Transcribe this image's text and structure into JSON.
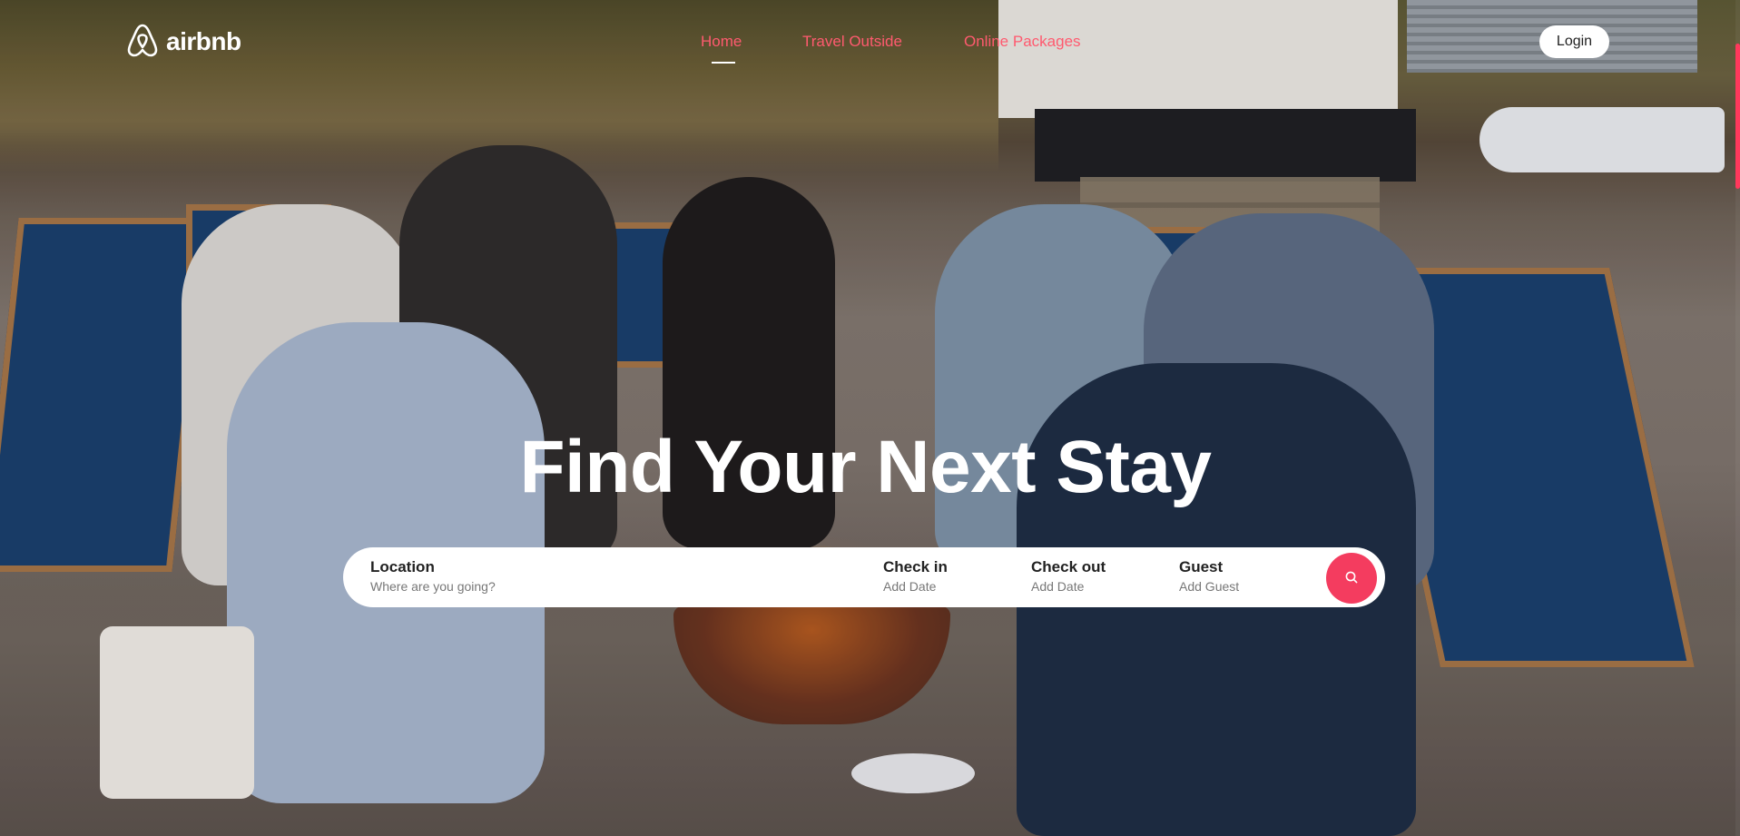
{
  "brand": {
    "name": "airbnb",
    "accent_color": "#ff385c",
    "logo_icon": "airbnb-belo-icon"
  },
  "nav": {
    "items": [
      {
        "label": "Home",
        "active": true
      },
      {
        "label": "Travel Outside",
        "active": false
      },
      {
        "label": "Online Packages",
        "active": false
      }
    ],
    "login_label": "Login"
  },
  "hero": {
    "headline": "Find Your Next Stay"
  },
  "search": {
    "location": {
      "label": "Location",
      "placeholder": "Where are you going?"
    },
    "check_in": {
      "label": "Check in",
      "value": "Add Date"
    },
    "check_out": {
      "label": "Check out",
      "value": "Add Date"
    },
    "guest": {
      "label": "Guest",
      "value": "Add Guest"
    },
    "button_icon": "search-icon"
  }
}
